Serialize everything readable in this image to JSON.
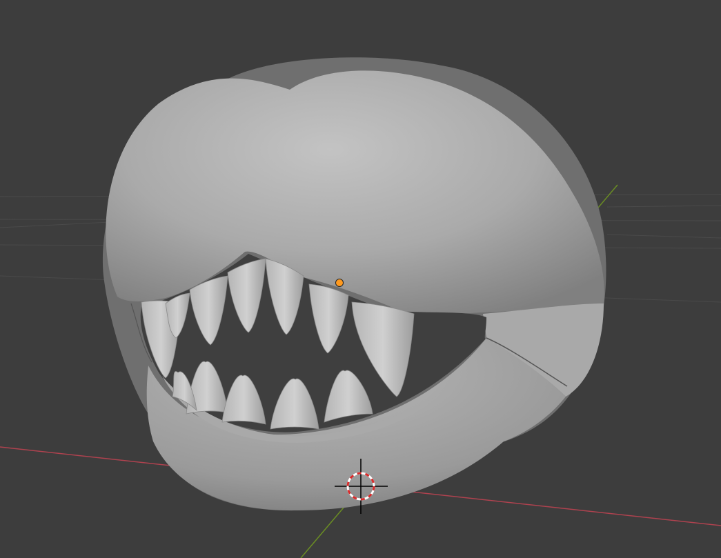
{
  "viewport": {
    "background_color": "#3d3d3d",
    "grid_color": "#4a4a4a",
    "x_axis_color": "#b0424f",
    "y_axis_color": "#6b8e23"
  },
  "object": {
    "name": "creature-mouth-mesh",
    "shading": "solid",
    "base_color": "#a9a9a9",
    "highlight_color": "#c4c4c4",
    "shadow_color": "#6f6f6f",
    "mouth_interior_color": "#3f3f3f",
    "upper_teeth_count": 7,
    "lower_teeth_count": 5,
    "origin_color": "#ff9a1f"
  },
  "cursor_3d": {
    "icon": "3d-cursor-icon",
    "ring_colors": [
      "#ffffff",
      "#d92b2b"
    ],
    "crosshair_color": "#000000"
  }
}
